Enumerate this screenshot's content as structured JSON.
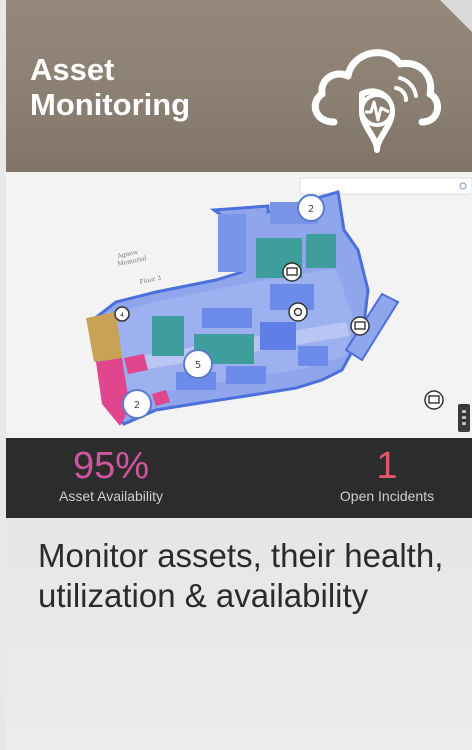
{
  "header": {
    "title_line1": "Asset",
    "title_line2": "Monitoring",
    "icon": "cloud-monitoring-icon"
  },
  "map": {
    "floor_label_line1": "Agnew",
    "floor_label_line2": "Memorial",
    "floor_label_line3": "Floor 3",
    "clusters": [
      "2",
      "5",
      "2"
    ],
    "small_marker": "4"
  },
  "stats": {
    "availability_value": "95",
    "availability_unit": "%",
    "availability_label": "Asset Availability",
    "incidents_value": "1",
    "incidents_label": "Open Incidents"
  },
  "description": "Monitor assets, their health, utilization & availability",
  "colors": {
    "header_bg": "#8a7f72",
    "stats_bg": "#2c2c2c",
    "availability_accent": "#d0559e",
    "incidents_accent": "#e2566b",
    "floor_blue": "#5b7fe6",
    "room_teal": "#3f9e9c"
  }
}
